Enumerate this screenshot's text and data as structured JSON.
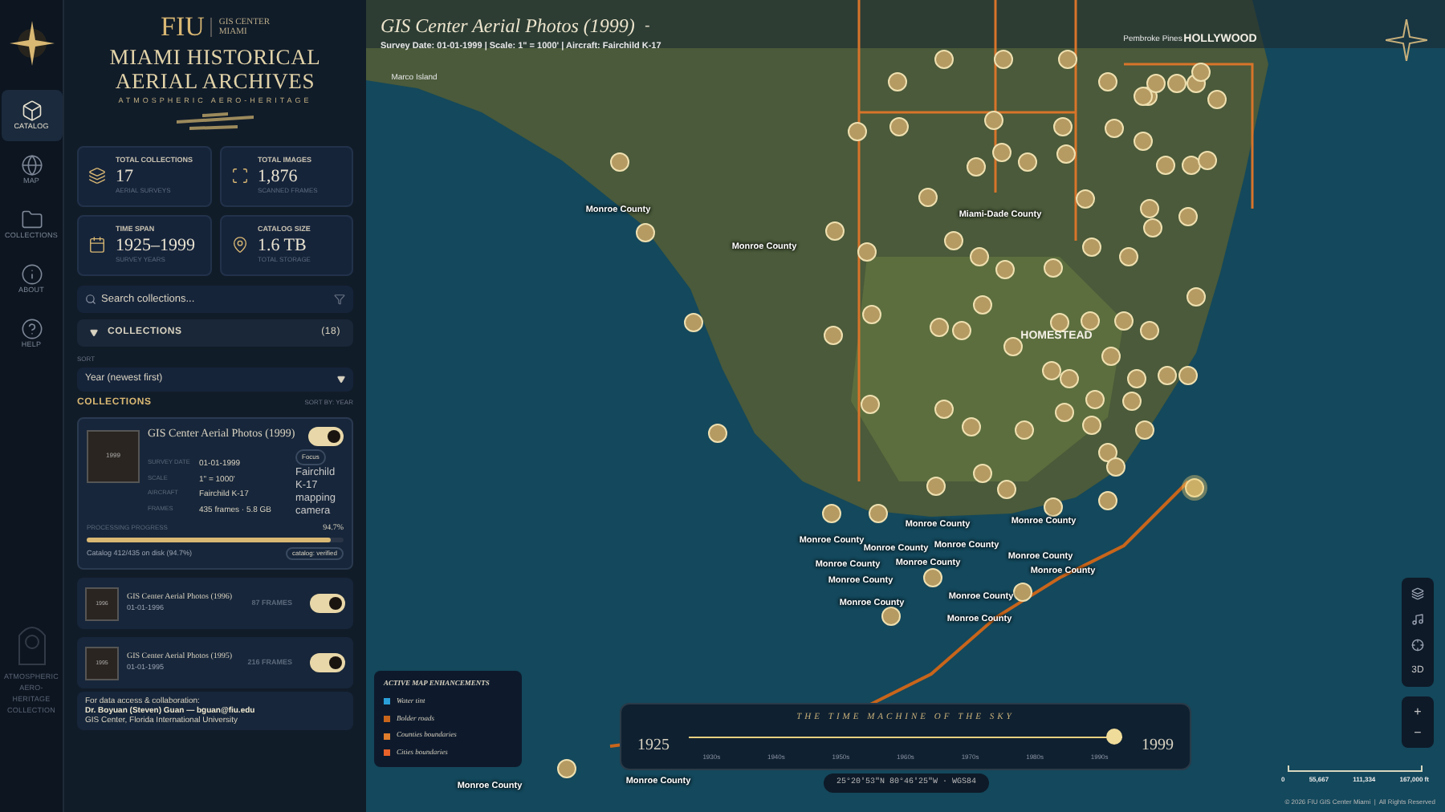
{
  "rail": {
    "items": [
      {
        "label": "CATALOG",
        "selected": true
      },
      {
        "label": "MAP",
        "selected": false
      },
      {
        "label": "COLLECTIONS",
        "selected": false
      },
      {
        "label": "ABOUT",
        "selected": false
      },
      {
        "label": "HELP",
        "selected": false
      }
    ],
    "emblem_text": "ATMOSPHERIC AERO-HERITAGE COLLECTION"
  },
  "header": {
    "logo": "FIU",
    "org": "GIS CENTER",
    "org_city": "MIAMI",
    "title_1": "MIAMI HISTORICAL",
    "title_2": "AERIAL ARCHIVES",
    "tagline": "ATMOSPHERIC AERO-HERITAGE"
  },
  "stats": [
    {
      "label": "TOTAL COLLECTIONS",
      "value": "17",
      "sub": "AERIAL SURVEYS"
    },
    {
      "label": "TOTAL IMAGES",
      "value": "1,876",
      "sub": "SCANNED FRAMES"
    },
    {
      "label": "TIME SPAN",
      "value": "1925–1999",
      "sub": "SURVEY YEARS"
    },
    {
      "label": "CATALOG SIZE",
      "value": "1.6 TB",
      "sub": "TOTAL STORAGE"
    }
  ],
  "search": {
    "placeholder": "Search collections..."
  },
  "collections_panel": {
    "label": "COLLECTIONS",
    "count": "(18)",
    "expanded": true
  },
  "sort": {
    "label": "SORT",
    "value": "Year (newest first)"
  },
  "list_header": {
    "title": "COLLECTIONS",
    "sort_note": "SORT BY: YEAR"
  },
  "featured": {
    "thumb": "1999",
    "title": "GIS Center Aerial Photos (1999)",
    "on": true,
    "focus": "Focus",
    "alt": "Fairchild K-17 mapping camera",
    "fields": [
      {
        "label": "SURVEY DATE",
        "value": "01-01-1999"
      },
      {
        "label": "SCALE",
        "value": "1\" = 1000'"
      },
      {
        "label": "AIRCRAFT",
        "value": "Fairchild K-17"
      },
      {
        "label": "FRAMES",
        "value": "435 frames · 5.8 GB"
      }
    ],
    "progress": {
      "label": "PROCESSING PROGRESS",
      "reading": "94.7%",
      "level": 0.947,
      "note": "Catalog 412/435 on disk (94.7%)",
      "badge": "catalog: verified"
    }
  },
  "items": [
    {
      "thumb": "1996",
      "title": "GIS Center Aerial Photos (1996)",
      "date": "01-01-1996",
      "frames": "87 FRAMES",
      "on": true
    },
    {
      "thumb": "1995",
      "title": "GIS Center Aerial Photos (1995)",
      "date": "01-01-1995",
      "frames": "216 FRAMES",
      "on": true
    }
  ],
  "contact": {
    "intro": "For data access & collaboration:",
    "name": "Dr. Boyuan (Steven) Guan — bguan@fiu.edu",
    "org": "GIS Center, Florida International University"
  },
  "map": {
    "title": "GIS Center Aerial Photos (1999)",
    "title_dash": "-",
    "subtitle": "Survey Date: 01-01-1999 | Scale: 1\" = 1000' | Aircraft: Fairchild K-17",
    "labels": [
      {
        "text": "Marco Island",
        "kind": "place"
      },
      {
        "text": "Pembroke Pines",
        "kind": "place"
      },
      {
        "text": "HOLLYWOOD",
        "kind": "city"
      },
      {
        "text": "HOMESTEAD",
        "kind": "city"
      },
      {
        "text": "Monroe County",
        "kind": "county"
      },
      {
        "text": "Monroe County",
        "kind": "county"
      },
      {
        "text": "Miami-Dade County",
        "kind": "county"
      },
      {
        "text": "Monroe County",
        "kind": "county"
      },
      {
        "text": "Monroe County",
        "kind": "county"
      },
      {
        "text": "Monroe County",
        "kind": "county"
      },
      {
        "text": "Monroe County",
        "kind": "county"
      },
      {
        "text": "Monroe County",
        "kind": "county"
      },
      {
        "text": "Monroe County",
        "kind": "county"
      },
      {
        "text": "Monroe County",
        "kind": "county"
      },
      {
        "text": "Monroe County",
        "kind": "county"
      },
      {
        "text": "Monroe County",
        "kind": "county"
      },
      {
        "text": "Monroe County",
        "kind": "county"
      },
      {
        "text": "Monroe County",
        "kind": "county"
      },
      {
        "text": "Monroe County",
        "kind": "county"
      },
      {
        "text": "Monroe County",
        "kind": "county"
      },
      {
        "text": "Monroe County",
        "kind": "county"
      },
      {
        "text": "Monroe County",
        "kind": "county"
      }
    ],
    "legend": {
      "title": "ACTIVE MAP ENHANCEMENTS",
      "items": [
        {
          "label": "Water tint",
          "color": "#2a9fd8"
        },
        {
          "label": "Bolder roads",
          "color": "#c8651b"
        },
        {
          "label": "Counties boundaries",
          "color": "#e07d2c"
        },
        {
          "label": "Cities boundaries",
          "color": "#e8622a"
        }
      ]
    },
    "timeline": {
      "title": "THE TIME MACHINE OF THE SKY",
      "start": "1925",
      "end": "1999",
      "level": 1,
      "decades": [
        "1930s",
        "1940s",
        "1950s",
        "1960s",
        "1970s",
        "1980s",
        "1990s"
      ]
    },
    "coords": "25°20'53\"N 80°46'25\"W · WGS84",
    "controls": [
      {
        "kind": "layers"
      },
      {
        "kind": "note"
      },
      {
        "kind": "locate"
      },
      {
        "kind": "text",
        "text": "3D"
      }
    ],
    "zoom": [
      "+",
      "−"
    ],
    "scale": [
      "0",
      "55,667",
      "111,334",
      "167,000 ft"
    ],
    "footer": "© 2026 FIU GIS Center Miami  |  All Rights Reserved"
  }
}
